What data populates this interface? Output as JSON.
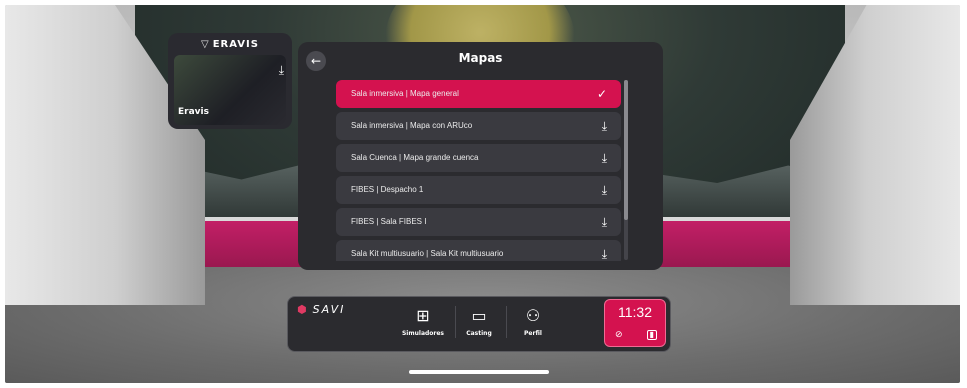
{
  "side_card": {
    "brand": "ERAVIS",
    "title": "Eravis"
  },
  "panel": {
    "title": "Mapas",
    "items": [
      {
        "label": "Sala inmersiva | Mapa general",
        "selected": true,
        "icon": "check-icon"
      },
      {
        "label": "Sala inmersiva | Mapa con ARUco",
        "selected": false,
        "icon": "download-icon"
      },
      {
        "label": "Sala Cuenca | Mapa grande cuenca",
        "selected": false,
        "icon": "download-icon"
      },
      {
        "label": "FIBES | Despacho 1",
        "selected": false,
        "icon": "download-icon"
      },
      {
        "label": "FIBES | Sala FIBES I",
        "selected": false,
        "icon": "download-icon"
      },
      {
        "label": "Sala Kit multiusuario | Sala Kit multiusuario",
        "selected": false,
        "icon": "download-icon"
      }
    ]
  },
  "dock": {
    "logo": "SAVI",
    "buttons": [
      {
        "label": "Simuladores",
        "icon": "grid-icon"
      },
      {
        "label": "Casting",
        "icon": "cast-icon"
      },
      {
        "label": "Perfil",
        "icon": "user-icon"
      }
    ],
    "clock": "11:32"
  },
  "colors": {
    "accent": "#d4124f",
    "panel_bg": "#2b2b2f"
  }
}
